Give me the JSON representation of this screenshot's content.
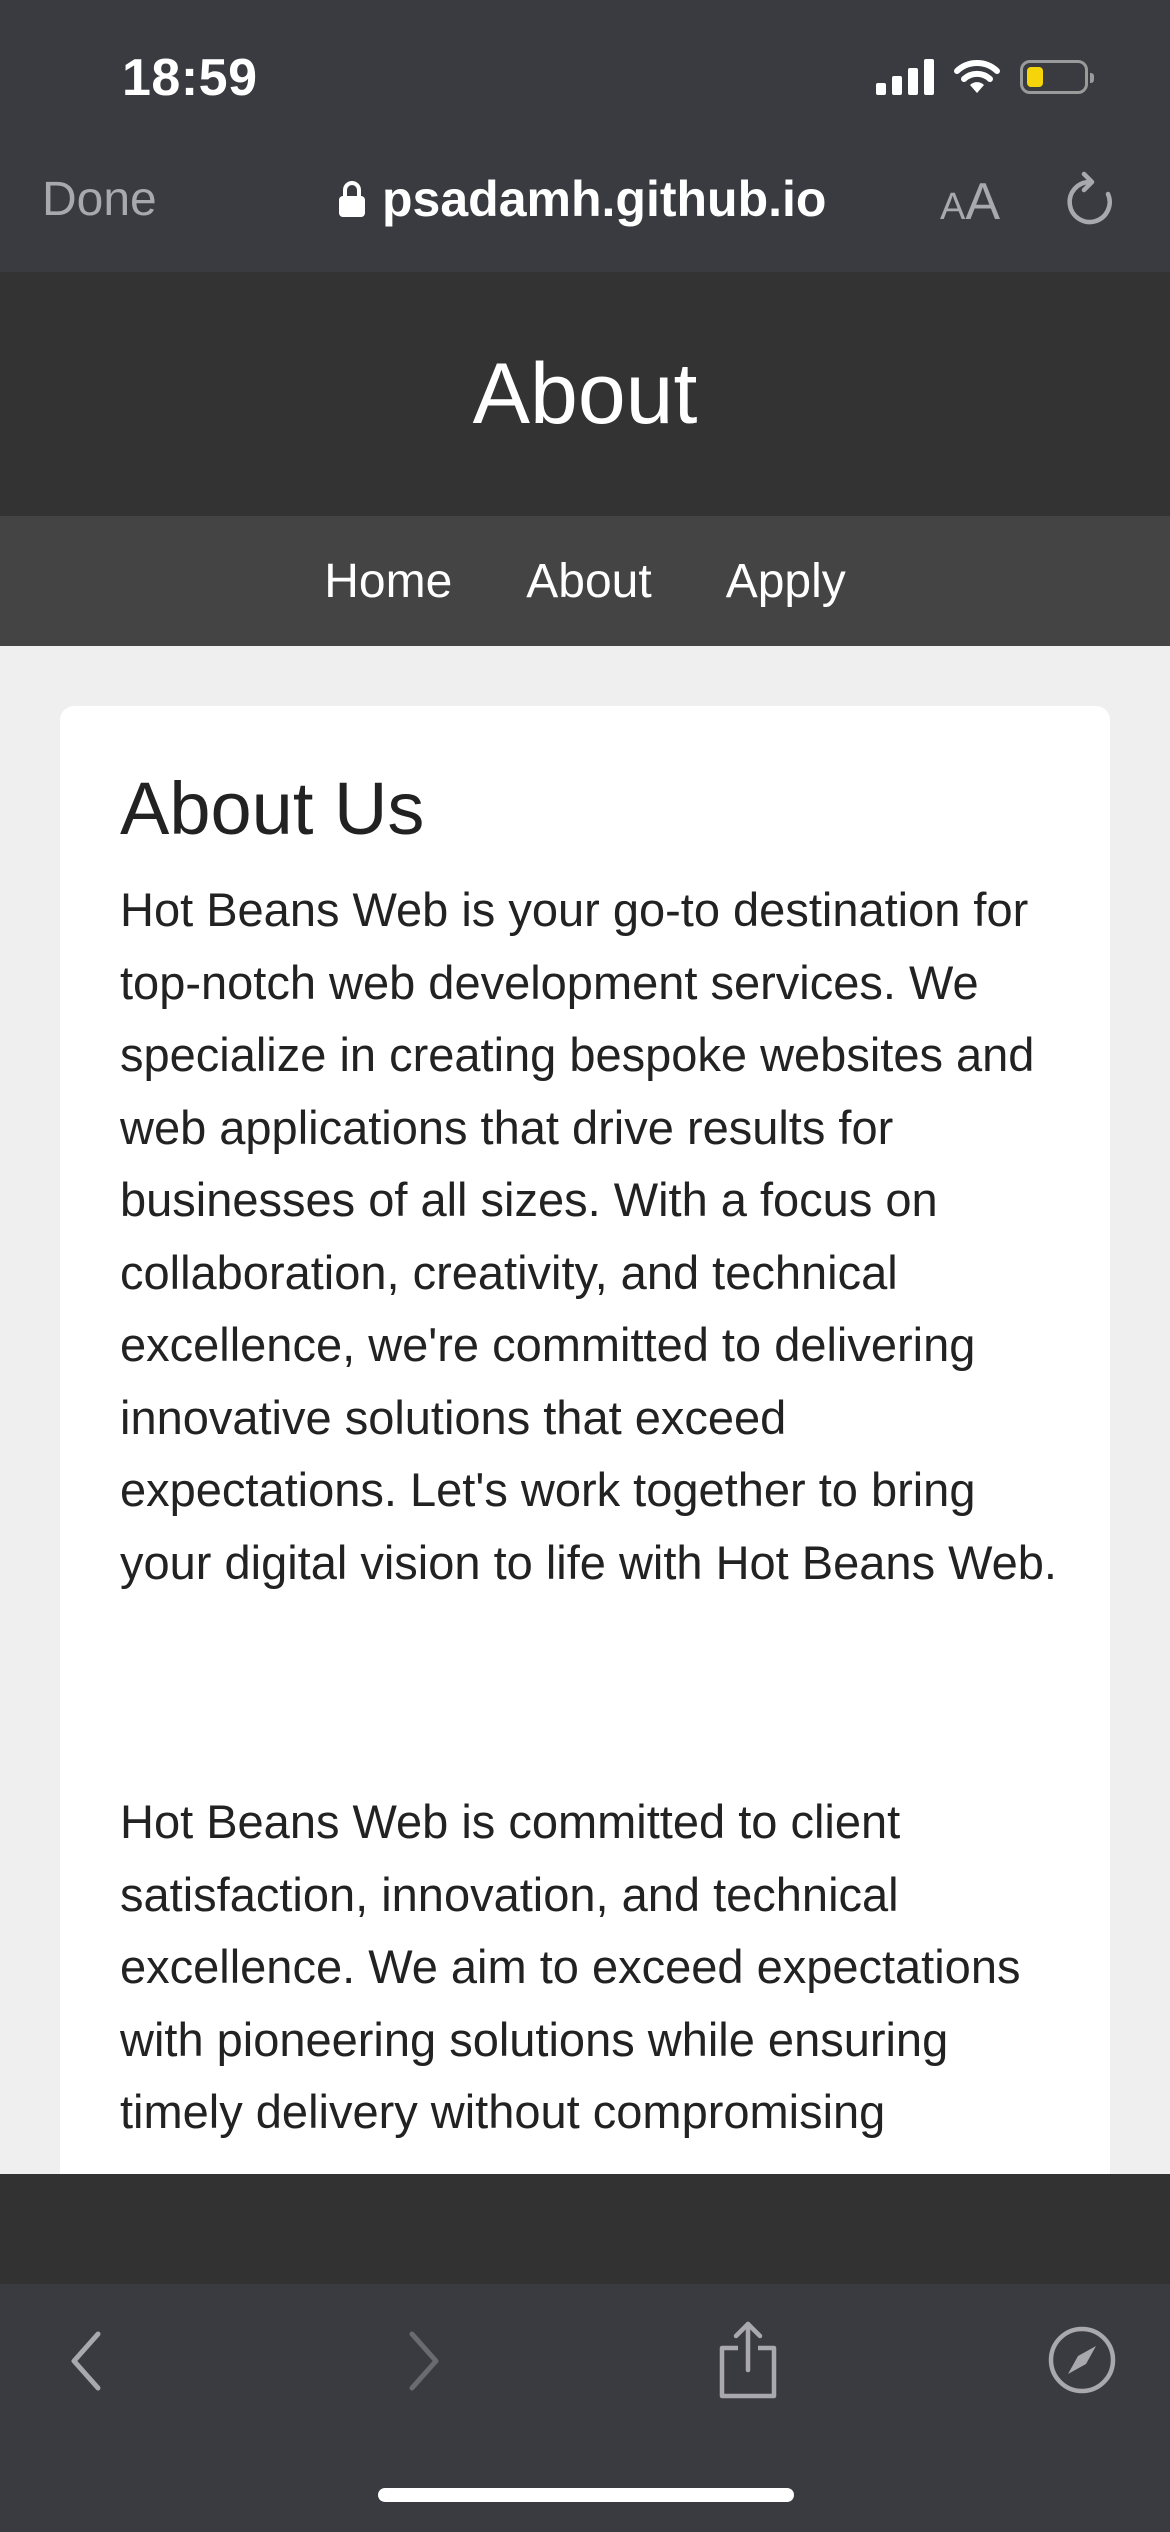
{
  "status_bar": {
    "time": "18:59",
    "icons": [
      "cellular-signal-icon",
      "wifi-icon",
      "battery-low-icon"
    ],
    "battery_color": "#f5d50a"
  },
  "browser": {
    "done_label": "Done",
    "url": "psadamh.github.io",
    "text_size_label_small": "A",
    "text_size_label_large": "A",
    "icons": [
      "lock-icon",
      "reload-icon",
      "back-icon",
      "forward-icon",
      "share-icon",
      "compass-icon"
    ]
  },
  "site": {
    "header_title": "About",
    "nav": [
      "Home",
      "About",
      "Apply"
    ],
    "colors": {
      "header": "#333333",
      "nav": "#444444",
      "page_bg": "#efefef"
    }
  },
  "content": {
    "heading": "About Us",
    "paragraph1": "Hot Beans Web is your go-to destination for top-notch web development services. We specialize in creating bespoke websites and web applications that drive results for businesses of all sizes. With a focus on collaboration, creativity, and technical excellence, we're committed to delivering innovative solutions that exceed expectations. Let's work together to bring your digital vision to life with Hot Beans Web.",
    "paragraph2": "Hot Beans Web is committed to client satisfaction, innovation, and technical excellence. We aim to exceed expectations with pioneering solutions while ensuring timely delivery without compromising"
  }
}
